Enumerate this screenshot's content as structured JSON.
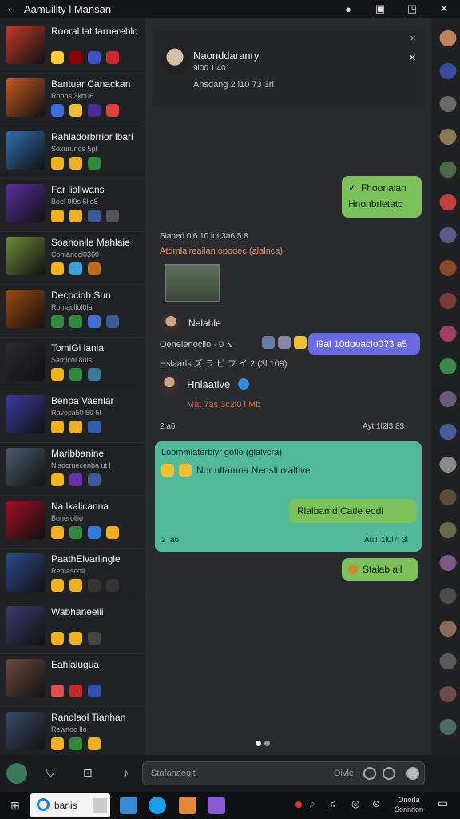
{
  "window": {
    "title": "Aamuility l Mansan"
  },
  "chats": [
    {
      "name": "Rooral lat farnereblo",
      "sub": "",
      "avatar_color": "#c0392b",
      "emojis": [
        "#ffcc33",
        "#8b0000",
        "#3f4fbf",
        "#cc2a2a"
      ]
    },
    {
      "name": "Bantuar Canackan",
      "sub": "Ronos 3kb06",
      "avatar_color": "#c45a1e",
      "emojis": [
        "#3f6fd6",
        "#f0c030",
        "#4a2a9a",
        "#e04040"
      ]
    },
    {
      "name": "Rahladorbrrior lbari",
      "sub": "Soxurunos 5pl",
      "avatar_color": "#2e6fae",
      "emojis": [
        "#f0b020",
        "#f0b020",
        "#2f8a3e"
      ]
    },
    {
      "name": "Far lialiwans",
      "sub": "Boel 9l9s 5llo8",
      "avatar_color": "#5a2fa0",
      "emojis": [
        "#f0b020",
        "#f0b020",
        "#3a5a9a",
        "#555"
      ]
    },
    {
      "name": "Soanonile Mahlaie",
      "sub": "Comanccl0360",
      "avatar_color": "#6f8a3a",
      "emojis": [
        "#f0b020",
        "#3aa0d6",
        "#c06a20"
      ]
    },
    {
      "name": "Decocioh Sun",
      "sub": "Romacllol0la",
      "avatar_color": "#9a4a10",
      "emojis": [
        "#2f8a3e",
        "#2f8a3e",
        "#3f6fd6",
        "#3a5a9a"
      ]
    },
    {
      "name": "TomiGi lania",
      "sub": "Samicol 80ls",
      "avatar_color": "#2a2a30",
      "emojis": [
        "#f0b020",
        "#2f8a3e",
        "#3a7a9a"
      ]
    },
    {
      "name": "Benpa Vaenlar",
      "sub": "Ravoca50 59 5l",
      "avatar_color": "#3a3aa0",
      "emojis": [
        "#f0b020",
        "#f0b020",
        "#2e5fae"
      ]
    },
    {
      "name": "Maribbanine",
      "sub": "Nisdcruecenba ut l",
      "avatar_color": "#4a5a6a",
      "emojis": [
        "#f0b020",
        "#6a2fb0",
        "#3a5a9a"
      ]
    },
    {
      "name": "Na lkalicanna",
      "sub": "Bonerollio",
      "avatar_color": "#a01020",
      "emojis": [
        "#f0b020",
        "#2f8a3e",
        "#2e7fd6",
        "#f0b020"
      ]
    },
    {
      "name": "PaathElvarlingle",
      "sub": "Remascoll",
      "avatar_color": "#2a4a8a",
      "emojis": [
        "#f0b020",
        "#f0b020",
        "#333",
        "#333"
      ]
    },
    {
      "name": "Wabhaneelii",
      "sub": "",
      "avatar_color": "#3a3a70",
      "emojis": [
        "#f0b020",
        "#f0b020",
        "#444"
      ]
    },
    {
      "name": "Eahlalugua",
      "sub": "",
      "avatar_color": "#6a4a3a",
      "emojis": [
        "#e05050",
        "#c02a2a",
        "#2e4fae"
      ]
    },
    {
      "name": "Randlaol Tianhan",
      "sub": "Rewrloo llo",
      "avatar_color": "#3a4a6a",
      "emojis": [
        "#f0b020",
        "#2f8a3e",
        "#f0b020"
      ]
    }
  ],
  "top_card": {
    "name": "Naonddaranry",
    "sub": "9l00 1l401",
    "meta": "Ansdang 2 l10 73 3rl",
    "close": "×",
    "close2": "×"
  },
  "messages": {
    "out1_line1": "Fhoonaian",
    "out1_line2": "Hnonbrletatb",
    "day1": "Slaned 0l6 10 lot 3a6 5 8",
    "fwd_header": "Atdmlalreailan opodec (alalnca)",
    "fwd_name": "Nelahle",
    "caption1": "Oeneienocilo · 0 ↘",
    "caption2": "Hslaarls ズ ラ ビ フ イ 2 (3l 109)",
    "blue_msg": "l9al 10dooaclo0?3 a5",
    "sender2": "Hnlaative",
    "sender2_meta": "Mat 7as 3c2l0 l Mb",
    "time1": "2:a6",
    "time1_right": "Ayt 1l2l3 83",
    "teal_header": "Loommlaterblyr gotlo (glalvcra)",
    "teal_text": "Nor ultamna Nensli olaltive",
    "teal_reply": "Rlalbamd Catle eodl",
    "time2": "2 :a6",
    "time2_right": "AuT 1l0l7l 3l",
    "out3": "Stalab all"
  },
  "composer": {
    "placeholder": "Stafanaegit",
    "secondary": "Oivle"
  },
  "taskbar": {
    "search": "banis",
    "clock_line1": "Onorla",
    "clock_line2": "Sonnrlon"
  },
  "colors": {
    "green": "#7bc25b",
    "blue": "#6a6ae2",
    "teal": "#52b99a",
    "orange": "#e6935a"
  }
}
